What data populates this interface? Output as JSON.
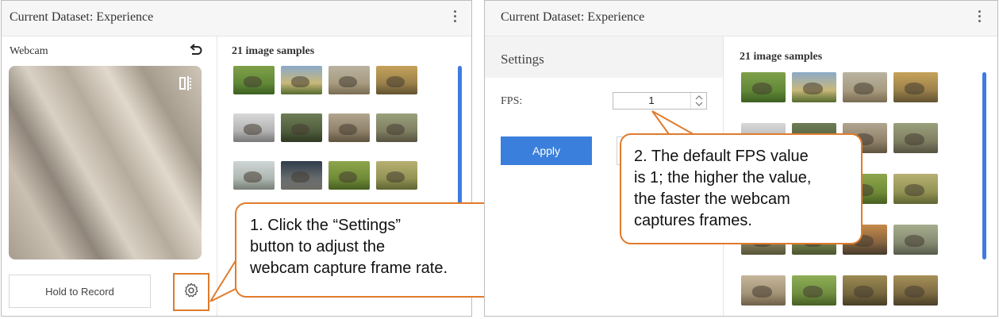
{
  "left_panel": {
    "title": "Current Dataset: Experience",
    "webcam_label": "Webcam",
    "samples_title": "21 image samples",
    "record_button": "Hold to Record"
  },
  "right_panel": {
    "title": "Current Dataset: Experience",
    "settings_title": "Settings",
    "fps_label": "FPS:",
    "fps_value": "1",
    "apply_button": "Apply",
    "samples_title": "21 image samples"
  },
  "callouts": {
    "one": [
      "1. Click the “Settings”",
      "button to adjust the",
      "webcam capture frame rate."
    ],
    "two": [
      "2. The default FPS value",
      "is 1; the higher the value,",
      "the faster the webcam",
      "captures frames."
    ]
  },
  "colors": {
    "accent_orange": "#e07b2c",
    "apply_blue": "#3b7fdc",
    "scrollbar_blue": "#3f7be0"
  },
  "thumbnails_left": [
    {
      "subject": "zebras grazing",
      "bg": "linear-gradient(#7fa04a,#4e7a2b)"
    },
    {
      "subject": "animals by lake",
      "bg": "linear-gradient(#8ba9c9,#c9b879 60%,#6f8b3f)"
    },
    {
      "subject": "elephants",
      "bg": "linear-gradient(#b9b3a1,#9c8b6a)"
    },
    {
      "subject": "rhinoceros",
      "bg": "linear-gradient(#c6a35a,#7e6a40)"
    },
    {
      "subject": "rhinoceros",
      "bg": "linear-gradient(#d8d8d8,#9b9b9b)"
    },
    {
      "subject": "zebra",
      "bg": "linear-gradient(#6e7d56,#3e4a2d)"
    },
    {
      "subject": "elephants",
      "bg": "linear-gradient(#b2a58f,#7a6b52)"
    },
    {
      "subject": "elephant",
      "bg": "linear-gradient(#9aa07b,#6e6a52)"
    },
    {
      "subject": "rhinos",
      "bg": "linear-gradient(#cfd6d6,#99a39a)"
    },
    {
      "subject": "elephants",
      "bg": "linear-gradient(#2f3c4b,#8a8a82)"
    },
    {
      "subject": "zebras",
      "bg": "linear-gradient(#8ea64c,#5c7a2a)"
    },
    {
      "subject": "antelopes",
      "bg": "linear-gradient(#b7b073,#7b8140)"
    }
  ],
  "thumbnails_right": [
    {
      "subject": "zebras grazing",
      "bg": "linear-gradient(#7fa04a,#4e7a2b)"
    },
    {
      "subject": "animals by lake",
      "bg": "linear-gradient(#8ba9c9,#c9b879 60%,#6f8b3f)"
    },
    {
      "subject": "elephants",
      "bg": "linear-gradient(#b9b3a1,#9c8b6a)"
    },
    {
      "subject": "rhinoceros",
      "bg": "linear-gradient(#c6a35a,#7e6a40)"
    },
    {
      "subject": "rhinoceros",
      "bg": "linear-gradient(#d8d8d8,#9b9b9b)"
    },
    {
      "subject": "zebra",
      "bg": "linear-gradient(#6e7d56,#3e4a2d)"
    },
    {
      "subject": "elephants",
      "bg": "linear-gradient(#b2a58f,#7a6b52)"
    },
    {
      "subject": "elephant",
      "bg": "linear-gradient(#9aa07b,#6e6a52)"
    },
    {
      "subject": "rhinos",
      "bg": "linear-gradient(#cfd6d6,#99a39a)"
    },
    {
      "subject": "elephants",
      "bg": "linear-gradient(#2f3c4b,#8a8a82)"
    },
    {
      "subject": "zebras",
      "bg": "linear-gradient(#8ea64c,#5c7a2a)"
    },
    {
      "subject": "antelopes",
      "bg": "linear-gradient(#b7b073,#7b8140)"
    },
    {
      "subject": "zebra herd",
      "bg": "linear-gradient(#a8a27a,#6f6a48)"
    },
    {
      "subject": "elephants",
      "bg": "linear-gradient(#98a56b,#5f6b3c)"
    },
    {
      "subject": "elephants at dusk",
      "bg": "linear-gradient(#c58a4a,#5b4a38)"
    },
    {
      "subject": "rhino",
      "bg": "linear-gradient(#a6ad8d,#6f7460)"
    },
    {
      "subject": "elephant on road",
      "bg": "linear-gradient(#c6b69a,#8d7c5e)"
    },
    {
      "subject": "elephants",
      "bg": "linear-gradient(#8fae57,#5b7a30)"
    },
    {
      "subject": "zebras",
      "bg": "linear-gradient(#9b8a52,#5c5030)"
    },
    {
      "subject": "zebras",
      "bg": "linear-gradient(#a68f58,#5f5132)"
    }
  ]
}
